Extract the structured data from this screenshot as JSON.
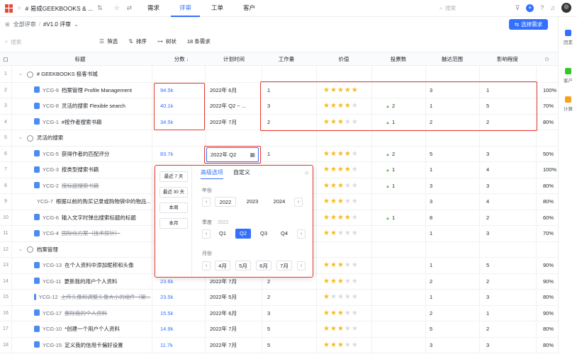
{
  "topbar": {
    "project_title": "# 易成GEEKBOOKS & ...",
    "tabs": [
      {
        "label": "需求",
        "active": false
      },
      {
        "label": "评审",
        "active": true
      },
      {
        "label": "工单",
        "active": false
      },
      {
        "label": "客户",
        "active": false
      }
    ],
    "search_placeholder": "搜索"
  },
  "breadcrumb": {
    "root": "全部评审",
    "sep": "/",
    "current": "#V1.0 评审"
  },
  "primary_button": "选择需求",
  "toolbar": {
    "search_placeholder": "搜索",
    "filter": "筛选",
    "sort": "排序",
    "tree": "树状",
    "count": "18 条需求"
  },
  "rail": [
    {
      "label": "因素",
      "color": "#3370ff"
    },
    {
      "label": "客户",
      "color": "#34c724"
    },
    {
      "label": "计算",
      "color": "#f7a21e"
    }
  ],
  "columns": {
    "title": "标题",
    "score": "分数",
    "plan": "计划时间",
    "work": "工作量",
    "value": "价值",
    "votes": "投票数",
    "reach": "触达范围",
    "impact": "影响程度"
  },
  "rows": [
    {
      "n": "1",
      "type": "group",
      "title": "# GEEKBOOKS 极客书城"
    },
    {
      "n": "2",
      "type": "item",
      "code": "YCG-9",
      "title": "档案管理 Profile Management",
      "score": "94.5k",
      "plan": "2022年 6月",
      "work": "1",
      "stars": 5,
      "votes": "",
      "reach": "3",
      "impact": "1",
      "pct": "100%",
      "strike": false
    },
    {
      "n": "3",
      "type": "item",
      "code": "YCG-8",
      "title": "灵活的搜索 Flexible search",
      "score": "40.1k",
      "plan": "2022年 Q2 ~ ...",
      "work": "3",
      "stars": 4,
      "votes": "2",
      "reach": "1",
      "impact": "5",
      "pct": "70%",
      "strike": false
    },
    {
      "n": "4",
      "type": "item",
      "code": "YCG-1",
      "title": "#按作者搜索书籍",
      "score": "34.5k",
      "plan": "2022年 7月",
      "work": "2",
      "stars": 3,
      "votes": "1",
      "reach": "2",
      "impact": "2",
      "pct": "80%",
      "strike": false
    },
    {
      "n": "5",
      "type": "group",
      "title": "灵活的搜索"
    },
    {
      "n": "6",
      "type": "item",
      "code": "YCG-5",
      "title": "获得作者的匹配评分",
      "score": "83.7k",
      "plan": "",
      "work": "1",
      "stars": 4,
      "votes": "2",
      "reach": "5",
      "impact": "3",
      "pct": "50%",
      "strike": false
    },
    {
      "n": "7",
      "type": "item",
      "code": "YCG-3",
      "title": "按类型搜索书籍",
      "score": "",
      "plan": "",
      "work": "",
      "stars": 4,
      "votes": "1",
      "reach": "1",
      "impact": "4",
      "pct": "100%",
      "strike": false
    },
    {
      "n": "8",
      "type": "item",
      "code": "YCG-2",
      "title": "按标题搜索书籍",
      "score": "",
      "plan": "",
      "work": "",
      "stars": 3,
      "votes": "1",
      "reach": "3",
      "impact": "3",
      "pct": "80%",
      "strike": true
    },
    {
      "n": "9",
      "type": "item",
      "code": "YCG-7",
      "title": "根据以前的购买记录或购物袋中的物品...",
      "score": "",
      "plan": "",
      "work": "",
      "stars": 3,
      "votes": "",
      "reach": "3",
      "impact": "4",
      "pct": "80%",
      "strike": false
    },
    {
      "n": "10",
      "type": "item",
      "code": "YCG-6",
      "title": "输入文字时弹出搜索标题的标题",
      "score": "",
      "plan": "",
      "work": "",
      "stars": 4,
      "votes": "1",
      "reach": "8",
      "impact": "2",
      "pct": "60%",
      "strike": false
    },
    {
      "n": "11",
      "type": "item",
      "code": "YCG-4",
      "title": "国际化方案（技术探针）",
      "score": "",
      "plan": "",
      "work": "",
      "stars": 2,
      "votes": "",
      "reach": "1",
      "impact": "3",
      "pct": "70%",
      "strike": true
    },
    {
      "n": "12",
      "type": "group",
      "title": "档案管理"
    },
    {
      "n": "13",
      "type": "item",
      "code": "YCG-13",
      "title": "在个人资料中添加昵称和头像",
      "score": "",
      "plan": "",
      "work": "",
      "stars": 3,
      "votes": "",
      "reach": "1",
      "impact": "5",
      "pct": "90%",
      "strike": false
    },
    {
      "n": "14",
      "type": "item",
      "code": "YCG-11",
      "title": "更新我的用户个人资料",
      "score": "23.6k",
      "plan": "2022年 7月",
      "work": "2",
      "stars": 3,
      "votes": "",
      "reach": "2",
      "impact": "2",
      "pct": "90%",
      "strike": false
    },
    {
      "n": "15",
      "type": "item",
      "code": "YCG-12",
      "title": "上传头像和调整头像大小的组件（架...",
      "score": "23.5k",
      "plan": "2022年 5月",
      "work": "2",
      "stars": 1,
      "votes": "",
      "reach": "1",
      "impact": "3",
      "pct": "80%",
      "strike": true
    },
    {
      "n": "16",
      "type": "item",
      "code": "YCG-17",
      "title": "删除我的个人资料",
      "score": "15.5k",
      "plan": "2022年 6月",
      "work": "3",
      "stars": 3,
      "votes": "",
      "reach": "2",
      "impact": "1",
      "pct": "90%",
      "strike": true
    },
    {
      "n": "17",
      "type": "item",
      "code": "YCG-10",
      "title": "*创建一个用户个人资料",
      "score": "14.9k",
      "plan": "2022年 7月",
      "work": "5",
      "stars": 3,
      "votes": "",
      "reach": "5",
      "impact": "2",
      "pct": "80%",
      "strike": false
    },
    {
      "n": "18",
      "type": "item",
      "code": "YCG-15",
      "title": "定义我的信用卡偏好设置",
      "score": "11.7k",
      "plan": "2022年 7月",
      "work": "5",
      "stars": 3,
      "votes": "",
      "reach": "3",
      "impact": "3",
      "pct": "80%",
      "strike": false
    }
  ],
  "date_input": {
    "value": "2022年 Q2"
  },
  "popup": {
    "quick": [
      "最近 7 天",
      "最近 30 天",
      "本周",
      "本月"
    ],
    "tabs": [
      {
        "label": "高级选项",
        "active": true
      },
      {
        "label": "自定义",
        "active": false
      }
    ],
    "year_label": "年份",
    "years": [
      "2022",
      "2023",
      "2024"
    ],
    "selected_year": "2022",
    "quarter_label": "季度",
    "quarter_sub": "2022",
    "quarters": [
      "Q1",
      "Q2",
      "Q3",
      "Q4"
    ],
    "selected_quarter": "Q2",
    "month_label": "月份",
    "months": [
      "4月",
      "5月",
      "6月",
      "7月"
    ]
  }
}
